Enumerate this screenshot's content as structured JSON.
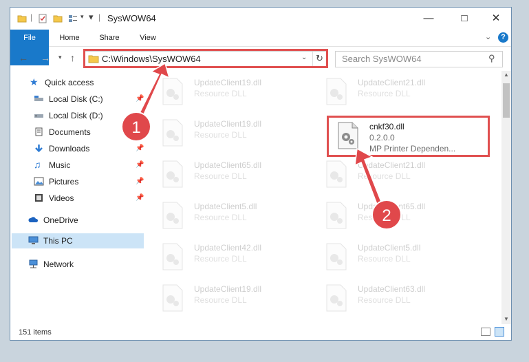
{
  "window": {
    "title": "SysWOW64"
  },
  "ribbon": {
    "tabs": [
      "File",
      "Home",
      "Share",
      "View"
    ]
  },
  "address": {
    "path": "C:\\Windows\\SysWOW64",
    "search_placeholder": "Search SysWOW64"
  },
  "sidebar": {
    "items": [
      {
        "label": "Quick access",
        "icon": "star-icon",
        "pinned": false
      },
      {
        "label": "Local Disk (C:)",
        "icon": "drive-icon",
        "pinned": true
      },
      {
        "label": "Local Disk (D:)",
        "icon": "drive-icon",
        "pinned": false
      },
      {
        "label": "Documents",
        "icon": "documents-icon",
        "pinned": true
      },
      {
        "label": "Downloads",
        "icon": "downloads-icon",
        "pinned": true
      },
      {
        "label": "Music",
        "icon": "music-icon",
        "pinned": true
      },
      {
        "label": "Pictures",
        "icon": "pictures-icon",
        "pinned": true
      },
      {
        "label": "Videos",
        "icon": "videos-icon",
        "pinned": true
      },
      {
        "label": "OneDrive",
        "icon": "cloud-icon",
        "pinned": false
      },
      {
        "label": "This PC",
        "icon": "computer-icon",
        "pinned": false,
        "selected": true
      },
      {
        "label": "Network",
        "icon": "network-icon",
        "pinned": false
      }
    ]
  },
  "files": [
    {
      "name": "UpdateClient19.dll",
      "type": "Resource DLL",
      "faded": true
    },
    {
      "name": "UpdateClient21.dll",
      "type": "Resource DLL",
      "faded": true
    },
    {
      "name": "UpdateClient19.dll",
      "type": "Resource DLL",
      "faded": true
    },
    {
      "name": "cnkf30.dll",
      "type": "0.2.0.0",
      "type2": "MP Printer Dependen...",
      "faded": false,
      "highlighted": true
    },
    {
      "name": "UpdateClient65.dll",
      "type": "Resource DLL",
      "faded": true
    },
    {
      "name": "UpdateClient21.dll",
      "type": "Resource DLL",
      "faded": true
    },
    {
      "name": "UpdateClient5.dll",
      "type": "Resource DLL",
      "faded": true
    },
    {
      "name": "UpdateClient65.dll",
      "type": "Resource DLL",
      "faded": true
    },
    {
      "name": "UpdateClient42.dll",
      "type": "Resource DLL",
      "faded": true
    },
    {
      "name": "UpdateClient5.dll",
      "type": "Resource DLL",
      "faded": true
    },
    {
      "name": "UpdateClient19.dll",
      "type": "Resource DLL",
      "faded": true
    },
    {
      "name": "UpdateClient63.dll",
      "type": "Resource DLL",
      "faded": true
    }
  ],
  "status": {
    "count": "151 items"
  },
  "annotations": {
    "step1": "1",
    "step2": "2"
  },
  "colors": {
    "accent": "#1979ca",
    "annotation_red": "#e0484b"
  }
}
